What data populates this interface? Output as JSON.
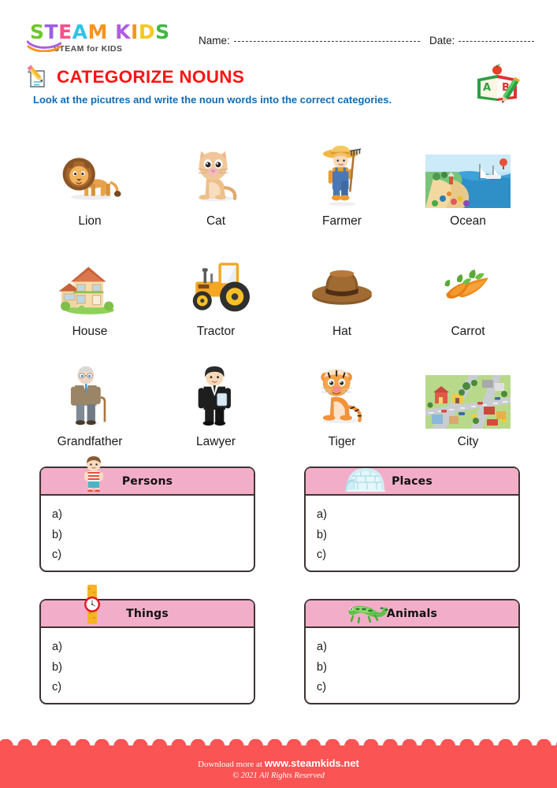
{
  "brand": {
    "logo_letters": [
      {
        "ch": "S",
        "color": "#6ec72d"
      },
      {
        "ch": "T",
        "color": "#9b5de5"
      },
      {
        "ch": "E",
        "color": "#f94f8a"
      },
      {
        "ch": "A",
        "color": "#2ec4e6"
      },
      {
        "ch": "M",
        "color": "#f79420"
      },
      {
        "ch": " ",
        "color": "#ffffff"
      },
      {
        "ch": "K",
        "color": "#b05ce0"
      },
      {
        "ch": "I",
        "color": "#f79420"
      },
      {
        "ch": "D",
        "color": "#f4c81e"
      },
      {
        "ch": "S",
        "color": "#3fb93f"
      }
    ],
    "logo_tagline": "STEAM for KIDS"
  },
  "header": {
    "name_label": "Name:",
    "date_label": "Date:",
    "abc_icon": "abc-book-icon",
    "book_letter_a": "A",
    "book_letter_b": "B"
  },
  "title": {
    "icon": "pencil-paper-icon",
    "text": "CATEGORIZE NOUNS",
    "color": "#fa1414",
    "subtitle": "Look at the picutres and write the noun words into the correct categories.",
    "subtitle_color": "#0f6cb5"
  },
  "pictures": [
    [
      {
        "label": "Lion",
        "icon": "lion-icon"
      },
      {
        "label": "Cat",
        "icon": "cat-icon"
      },
      {
        "label": "Farmer",
        "icon": "farmer-icon"
      },
      {
        "label": "Ocean",
        "icon": "ocean-beach-icon"
      }
    ],
    [
      {
        "label": "House",
        "icon": "house-icon"
      },
      {
        "label": "Tractor",
        "icon": "tractor-icon"
      },
      {
        "label": "Hat",
        "icon": "hat-icon"
      },
      {
        "label": "Carrot",
        "icon": "carrot-icon"
      }
    ],
    [
      {
        "label": "Grandfather",
        "icon": "grandfather-icon"
      },
      {
        "label": "Lawyer",
        "icon": "lawyer-icon"
      },
      {
        "label": "Tiger",
        "icon": "tiger-icon"
      },
      {
        "label": "City",
        "icon": "city-icon"
      }
    ]
  ],
  "categories": [
    {
      "title": "Persons",
      "icon": "boy-icon",
      "lines": [
        "a)",
        "b)",
        "c)"
      ]
    },
    {
      "title": "Places",
      "icon": "igloo-icon",
      "lines": [
        "a)",
        "b)",
        "c)"
      ]
    },
    {
      "title": "Things",
      "icon": "watch-icon",
      "lines": [
        "a)",
        "b)",
        "c)"
      ]
    },
    {
      "title": "Animals",
      "icon": "iguana-icon",
      "lines": [
        "a)",
        "b)",
        "c)"
      ]
    }
  ],
  "category_header_color": "#f2aec8",
  "footer": {
    "download_prefix": "Download more at",
    "site": "www.steamkids.net",
    "copyright": "© 2021 All Rights Reserved",
    "band_color": "#fa5454"
  }
}
